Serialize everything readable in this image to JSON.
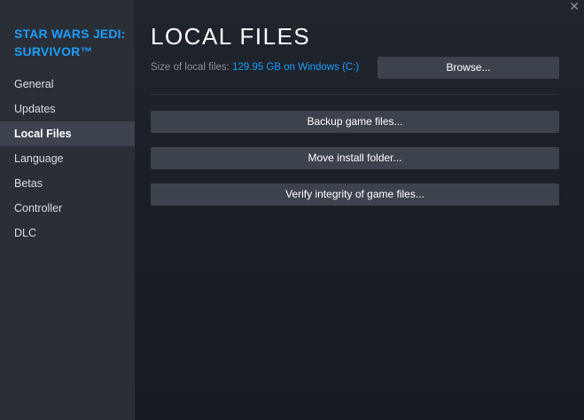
{
  "sidebar": {
    "game_title": "STAR WARS JEDI: SURVIVOR™",
    "items": [
      {
        "label": "General"
      },
      {
        "label": "Updates"
      },
      {
        "label": "Local Files"
      },
      {
        "label": "Language"
      },
      {
        "label": "Betas"
      },
      {
        "label": "Controller"
      },
      {
        "label": "DLC"
      }
    ],
    "active_item": "Local Files"
  },
  "main": {
    "close_glyph": "✕",
    "title": "LOCAL FILES",
    "size_label": "Size of local files:",
    "size_value": "129.95 GB on Windows (C:)",
    "browse_label": "Browse...",
    "backup_label": "Backup game files...",
    "move_label": "Move install folder...",
    "verify_label": "Verify integrity of game files..."
  },
  "colors": {
    "accent": "#1a9fff",
    "sidebar_bg": "#2a2e36",
    "active_item_bg": "#3d4450",
    "button_bg": "#3d434d",
    "main_bg": "#1b1f27"
  }
}
